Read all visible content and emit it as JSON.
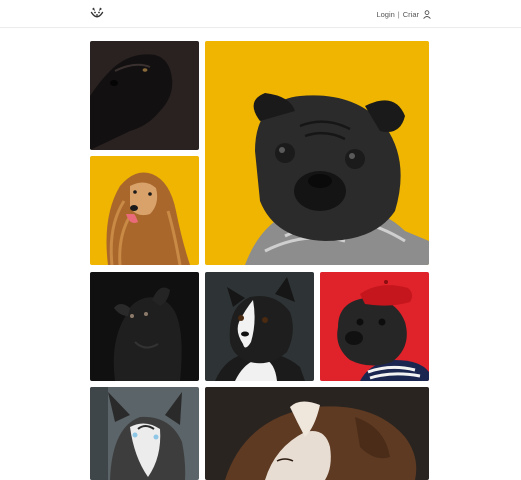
{
  "header": {
    "logo_icon": "dog-face-icon",
    "login_label": "Login",
    "separator": "|",
    "signup_label": "Criar",
    "user_icon": "user-icon"
  },
  "colors": {
    "accent_yellow": "#f0b400",
    "accent_red": "#e0222a",
    "text": "#555555"
  },
  "gallery": {
    "photos": [
      {
        "subject": "black-dog-portrait"
      },
      {
        "subject": "pug-with-sweater-yellow"
      },
      {
        "subject": "afghan-hound-yellow"
      },
      {
        "subject": "black-dog-looking-up"
      },
      {
        "subject": "boston-terrier"
      },
      {
        "subject": "pug-with-beret-red"
      },
      {
        "subject": "husky"
      },
      {
        "subject": "puppy-sleeping"
      }
    ]
  }
}
